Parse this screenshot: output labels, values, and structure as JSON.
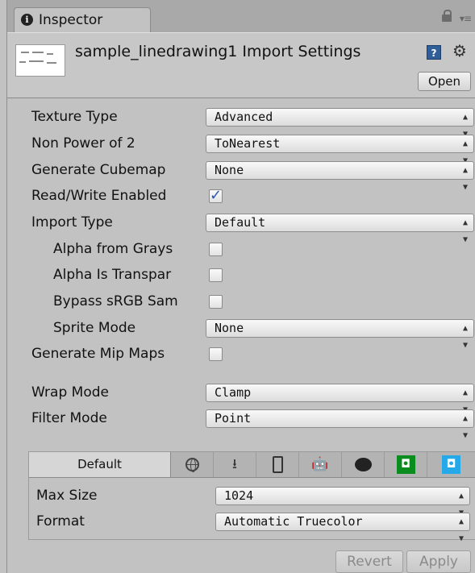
{
  "tab": {
    "label": "Inspector",
    "icon": "info-icon"
  },
  "header": {
    "title": "sample_linedrawing1 Import Settings",
    "open_label": "Open"
  },
  "fields": {
    "texture_type": {
      "label": "Texture Type",
      "value": "Advanced"
    },
    "non_power_of_2": {
      "label": "Non Power of 2",
      "value": "ToNearest"
    },
    "generate_cubemap": {
      "label": "Generate Cubemap",
      "value": "None"
    },
    "read_write": {
      "label": "Read/Write Enabled",
      "checked": true
    },
    "import_type": {
      "label": "Import Type",
      "value": "Default"
    },
    "alpha_from_grays": {
      "label": "Alpha from Grays",
      "checked": false
    },
    "alpha_is_transparency": {
      "label": "Alpha Is Transpar",
      "checked": false
    },
    "bypass_srgb": {
      "label": "Bypass sRGB Sam",
      "checked": false
    },
    "sprite_mode": {
      "label": "Sprite Mode",
      "value": "None"
    },
    "generate_mip_maps": {
      "label": "Generate Mip Maps",
      "checked": false
    },
    "wrap_mode": {
      "label": "Wrap Mode",
      "value": "Clamp"
    },
    "filter_mode": {
      "label": "Filter Mode",
      "value": "Point"
    }
  },
  "platforms": {
    "default_label": "Default",
    "tabs": [
      "web-globe-icon",
      "download-icon",
      "mobile-phone-icon",
      "android-icon",
      "blackberry-icon",
      "windows-store-green-icon",
      "windows-store-blue-icon"
    ],
    "max_size": {
      "label": "Max Size",
      "value": "1024"
    },
    "format": {
      "label": "Format",
      "value": "Automatic Truecolor"
    }
  },
  "footer": {
    "revert_label": "Revert",
    "apply_label": "Apply"
  },
  "colors": {
    "checkmark": "#2858b5",
    "help_icon": "#2f5e99",
    "store_green": "#0a8c1e",
    "store_blue": "#26a9e8"
  }
}
